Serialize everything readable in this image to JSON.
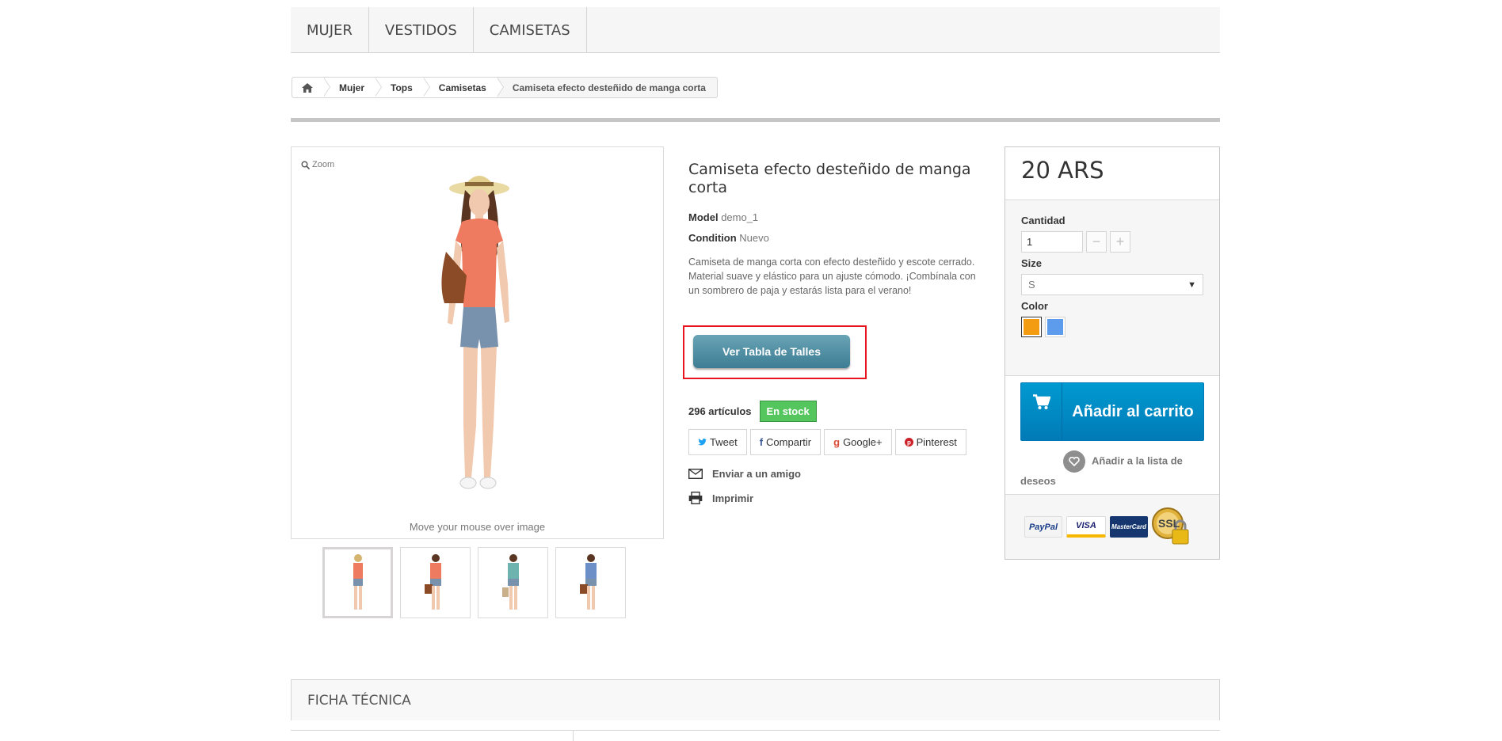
{
  "topmenu": {
    "items": [
      "MUJER",
      "VESTIDOS",
      "CAMISETAS"
    ]
  },
  "breadcrumb": {
    "items": [
      "Mujer",
      "Tops",
      "Camisetas"
    ],
    "current": "Camiseta efecto desteñido de manga corta"
  },
  "image": {
    "zoom_label": "Zoom",
    "caption": "Move your mouse over image",
    "thumb_count": 4
  },
  "product": {
    "title": "Camiseta efecto desteñido de manga corta",
    "model_label": "Model",
    "model_value": "demo_1",
    "condition_label": "Condition",
    "condition_value": "Nuevo",
    "description": "Camiseta de manga corta con efecto desteñido y escote cerrado. Material suave y elástico para un ajuste cómodo. ¡Combínala con un sombrero de paja y estarás lista para el verano!",
    "size_chart_button": "Ver Tabla de Talles",
    "stock_qty": "296 artículos",
    "stock_badge": "En stock"
  },
  "social": {
    "tweet": "Tweet",
    "share": "Compartir",
    "google": "Google+",
    "pinterest": "Pinterest"
  },
  "links": {
    "send_friend": "Enviar a un amigo",
    "print": "Imprimir"
  },
  "buybox": {
    "price": "20 ARS",
    "quantity_label": "Cantidad",
    "quantity_value": "1",
    "size_label": "Size",
    "size_value": "S",
    "color_label": "Color",
    "colors": [
      "#f39c11",
      "#5d9cec"
    ],
    "add_to_cart": "Añadir al carrito",
    "wishlist": "Añadir a la lista de deseos",
    "payment": {
      "paypal": "PayPal",
      "visa": "VISA",
      "mastercard": "MasterCard",
      "ssl": "SSL"
    }
  },
  "ficha": {
    "title": "FICHA TÉCNICA"
  },
  "colors": {
    "stock_green": "#55c65e",
    "cart_blue": "#009ad0",
    "highlight_red": "#e8151f",
    "talles_teal": "#4f8ea3"
  }
}
